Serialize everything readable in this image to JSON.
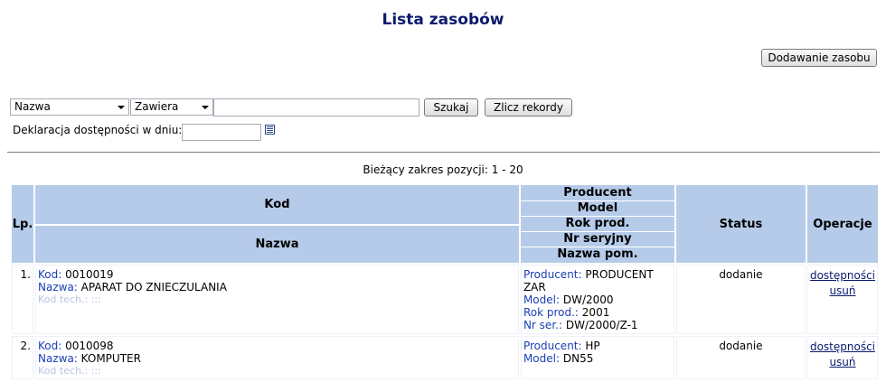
{
  "page": {
    "title": "Lista zasobów"
  },
  "toolbar": {
    "add_label": "Dodawanie zasobu"
  },
  "search": {
    "field_select": "Nazwa",
    "mode_select": "Zawiera",
    "query_value": "",
    "search_label": "Szukaj",
    "count_label": "Zlicz rekordy",
    "date_label": "Deklaracja dostępności w dniu:",
    "date_value": ""
  },
  "range_text": "Bieżący zakres pozycji: 1 - 20",
  "table": {
    "headers": {
      "lp": "Lp.",
      "kod": "Kod",
      "nazwa": "Nazwa",
      "producent": "Producent",
      "model": "Model",
      "rok": "Rok prod.",
      "nr": "Nr seryjny",
      "nazwa_pom": "Nazwa pom.",
      "status": "Status",
      "operacje": "Operacje"
    },
    "rows": [
      {
        "lp": "1.",
        "kod_label": "Kod:",
        "kod": "0010019",
        "nazwa_label": "Nazwa:",
        "nazwa": "APARAT DO ZNIECZULANIA",
        "kodtech_label": "Kod tech.:",
        "kodtech": ":::",
        "producent_label": "Producent:",
        "producent": "PRODUCENT ZAR",
        "model_label": "Model:",
        "model": "DW/2000",
        "rok_label": "Rok prod.:",
        "rok": "2001",
        "nr_label": "Nr ser.:",
        "nr": "DW/2000/Z-1",
        "status": "dodanie",
        "op1": "dostępności",
        "op2": "usuń"
      },
      {
        "lp": "2.",
        "kod_label": "Kod:",
        "kod": "0010098",
        "nazwa_label": "Nazwa:",
        "nazwa": "KOMPUTER",
        "kodtech_label": "Kod tech.:",
        "kodtech": ":::",
        "producent_label": "Producent:",
        "producent": "HP",
        "model_label": "Model:",
        "model": "DN55",
        "status": "dodanie",
        "op1": "dostępności",
        "op2": "usuń"
      }
    ]
  }
}
